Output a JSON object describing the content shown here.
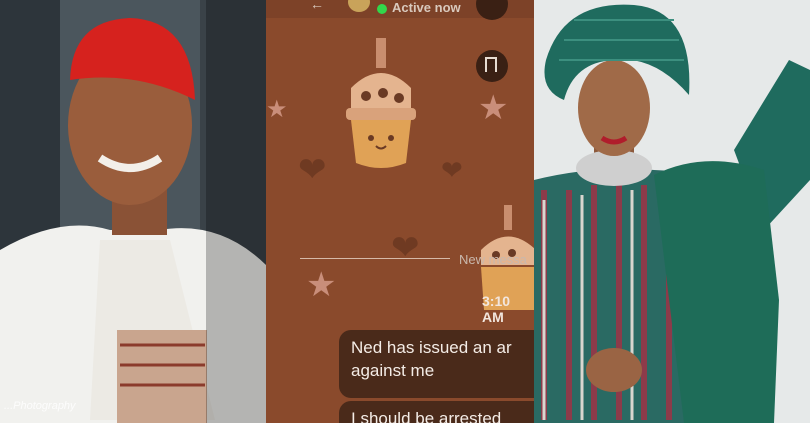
{
  "chat": {
    "status": "Active now",
    "divider_label": "New messa",
    "timestamp": "3:10 AM",
    "messages": [
      {
        "text": "Ned has issued an ar against me"
      },
      {
        "text": "I should be arrested"
      }
    ]
  },
  "left_photo": {
    "watermark": "...Photography"
  },
  "colors": {
    "chat_background": "#8a4a2c",
    "bubble": "#4a2a1a",
    "active_dot": "#32d74b",
    "red_cap": "#d6221e",
    "green_gele": "#1f6b5e"
  },
  "icons": [
    "back-arrow-icon",
    "bookmark-icon",
    "boba-sticker-icon",
    "heart-icon",
    "star-icon"
  ]
}
